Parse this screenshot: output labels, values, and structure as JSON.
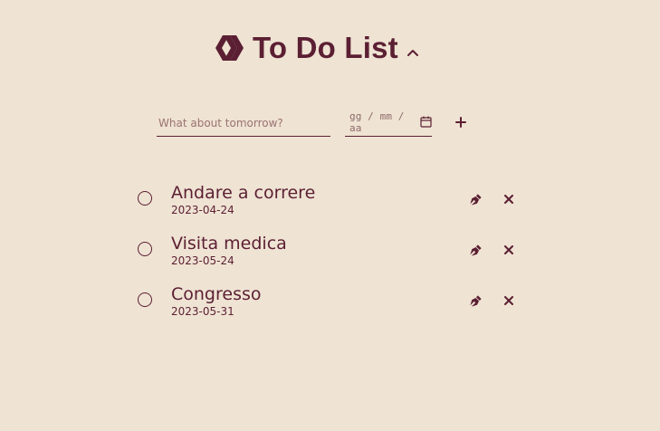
{
  "header": {
    "title": "To Do List",
    "logo_icon": "double-chevron-diamond-logo-icon",
    "collapse_icon": "chevron-up-icon"
  },
  "form": {
    "task_placeholder": "What about tomorrow?",
    "task_value": "",
    "date_placeholder": "gg / mm / aa",
    "calendar_icon": "calendar-icon",
    "add_icon": "plus-icon"
  },
  "todos": [
    {
      "title": "Andare a correre",
      "date": "2023-04-24",
      "done": false
    },
    {
      "title": "Visita medica",
      "date": "2023-05-24",
      "done": false
    },
    {
      "title": "Congresso",
      "date": "2023-05-31",
      "done": false
    }
  ],
  "icons": {
    "edit": "pen-nib-icon",
    "delete": "close-icon"
  },
  "colors": {
    "background": "#efe3d3",
    "primary": "#5b1f33"
  }
}
